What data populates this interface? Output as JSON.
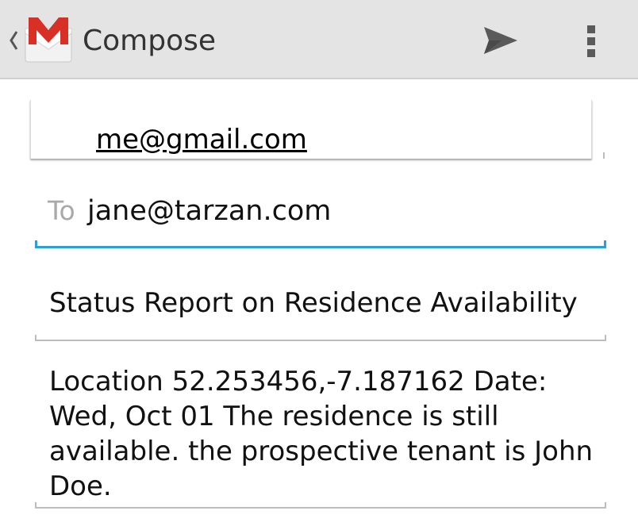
{
  "actionbar": {
    "title": "Compose",
    "colors": {
      "background": "#e4e4e4",
      "gmail_red": "#d93025",
      "icon_gray": "#5a5a5a"
    },
    "icons": [
      "up-caret-icon",
      "gmail-envelope-icon",
      "send-icon",
      "overflow-menu-icon"
    ]
  },
  "from": {
    "value": "me@gmail.com"
  },
  "to": {
    "label": "To",
    "value": "jane@tarzan.com",
    "accent_color": "#2aa0d6"
  },
  "subject": {
    "value": "Status Report on Residence Availability"
  },
  "body": {
    "value": "Location 52.253456,-7.187162 Date: Wed, Oct 01 The residence is still available. the prospective tenant is John Doe."
  }
}
